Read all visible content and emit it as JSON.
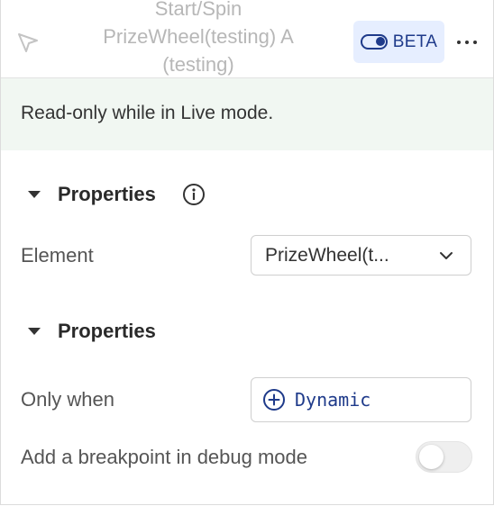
{
  "header": {
    "title": "Start/Spin PrizeWheel(testing) A (testing)",
    "beta_label": "BETA"
  },
  "banner": {
    "text": "Read-only while in Live mode."
  },
  "sections": [
    {
      "title": "Properties",
      "rows": [
        {
          "label": "Element",
          "value": "PrizeWheel(t..."
        }
      ]
    },
    {
      "title": "Properties",
      "rows": [
        {
          "label": "Only when",
          "value": "Dynamic"
        },
        {
          "label": "Add a breakpoint in debug mode",
          "toggle_on": false
        }
      ]
    }
  ],
  "icons": {
    "header": "cursor-pointer-icon",
    "beta": "toggle-icon",
    "menu": "more-horizontal-icon",
    "info": "info-icon",
    "select": "chevron-down-icon",
    "dynamic": "plus-circle-icon"
  },
  "colors": {
    "accent": "#1e3a8a",
    "beta_background": "#e6eeff",
    "banner_background": "#f1f7f2",
    "title_text": "#b7b7b7"
  }
}
